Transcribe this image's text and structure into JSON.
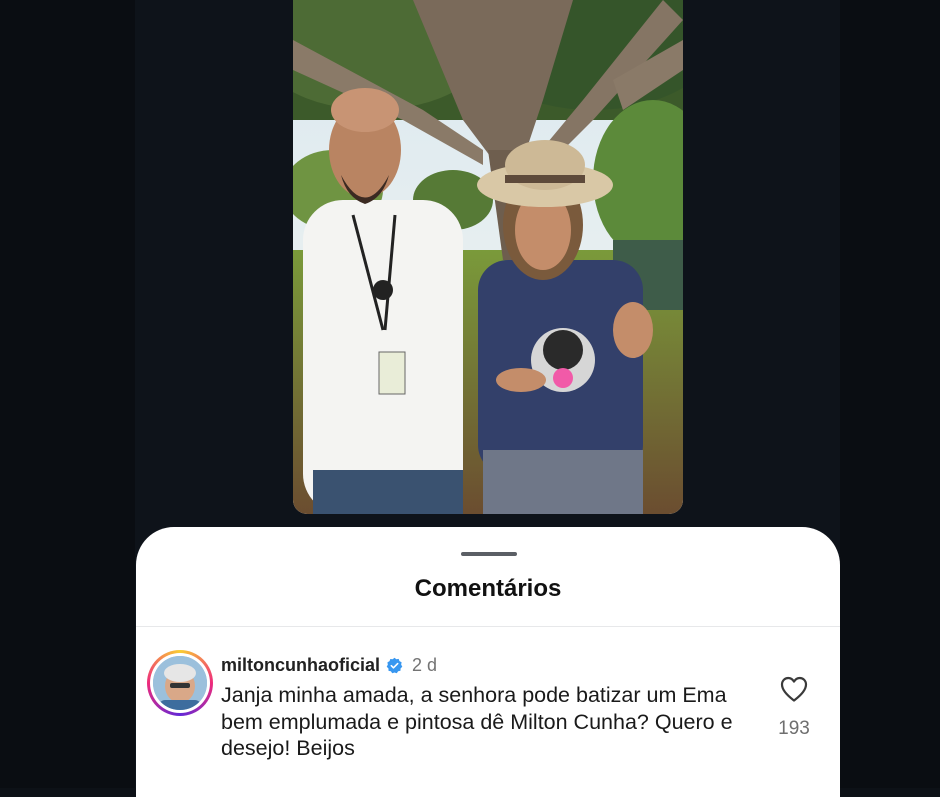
{
  "post": {
    "image": "video-frame-two-people-under-tree"
  },
  "comments_sheet": {
    "title": "Comentários",
    "comments": [
      {
        "username": "miltoncunhaoficial",
        "verified": true,
        "time": "2 d",
        "text": "Janja minha amada, a senhora pode batizar um Ema bem emplumada e pintosa dê Milton Cunha? Quero e desejo! Beijos",
        "like_icon": "heart-outline-icon",
        "likes": "193"
      }
    ]
  },
  "colors": {
    "background": "#0d1117",
    "sheet": "#ffffff",
    "verified": "#3897f0",
    "meta_text": "#737373"
  }
}
